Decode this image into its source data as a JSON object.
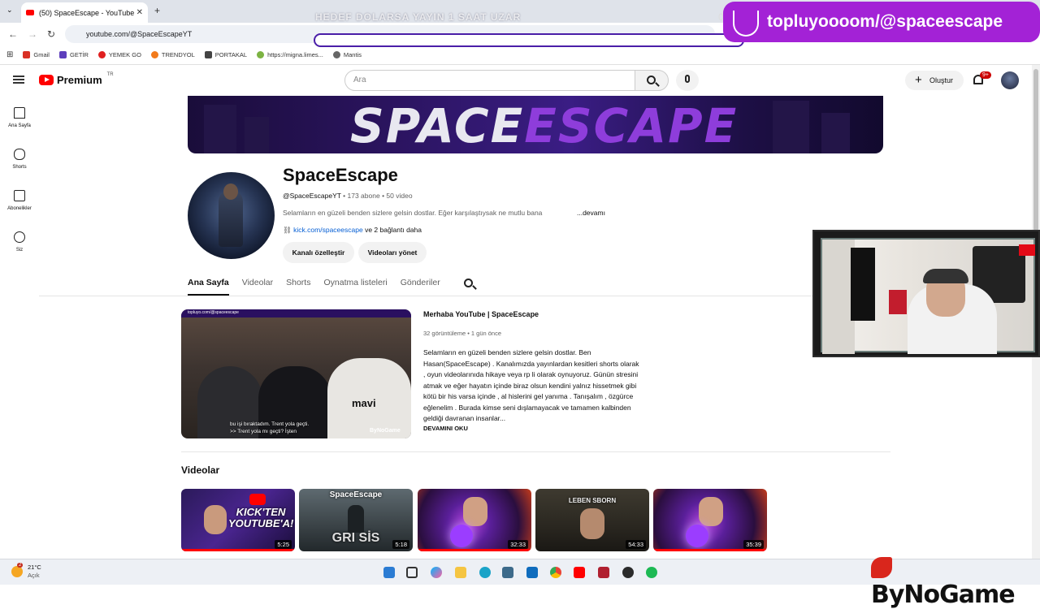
{
  "browser": {
    "tab_title": "(50) SpaceEscape - YouTube",
    "url": "youtube.com/@SpaceEscapeYT",
    "bookmarks": [
      "Gmail",
      "GETİR",
      "YEMEK GO",
      "TRENDYOL",
      "PORTAKAL",
      "https://migna.limes...",
      "Mantis"
    ]
  },
  "overlay": {
    "marquee": "HEDEF DOLARSA YAYIN 1 SAAT UZAR",
    "counter": "0",
    "kick": "topluyoooom/@spaceescape",
    "brand": "ByNoGame"
  },
  "yt": {
    "logo": "Premium",
    "region": "TR",
    "search_placeholder": "Ara",
    "create": "Oluştur",
    "notif_count": "9+",
    "nav": [
      "Ana Sayfa",
      "Shorts",
      "Abonelikler",
      "Siz"
    ]
  },
  "channel": {
    "banner_text_a": "SPACE",
    "banner_text_b": "ESCAPE",
    "name": "SpaceEscape",
    "handle": "@SpaceEscapeYT",
    "subs": "173 abone",
    "videos": "50 video",
    "description": "Selamların en güzeli benden sizlere gelsin dostlar. Eğer karşılaştıysak ne mutlu bana",
    "more": "...devamı",
    "link": "kick.com/spaceescape",
    "link_more": "ve 2 bağlantı daha",
    "btn_customize": "Kanalı özelleştir",
    "btn_manage": "Videoları yönet",
    "tabs": [
      "Ana Sayfa",
      "Videolar",
      "Shorts",
      "Oynatma listeleri",
      "Gönderiler"
    ]
  },
  "featured": {
    "title": "Merhaba YouTube | SpaceEscape",
    "meta": "32 görüntüleme • 1 gün önce",
    "description": "Selamların en güzeli benden sizlere gelsin dostlar. Ben Hasan(SpaceEscape) . Kanalımızda yayınlardan kesitleri shorts olarak , oyun videolarınıda hikaye veya rp li olarak oynuyoruz. Günün stresini atmak ve eğer hayatın içinde biraz olsun kendini yalnız hissetmek gibi kötü bir his varsa içinde , al hislerini gel yanıma . Tanışalım , özgürce eğlenelim . Burada kimse seni dışlamayacak ve tamamen kalbinden geldiği davranan insanlar...",
    "read_more": "DEVAMINI OKU",
    "caption1": "bu işi bıraktadım. Trent yola geçti.",
    "caption2": ">> Trent yola mı geçti? İşten",
    "shirt": "mavi",
    "overlay_kick": "topluyo.com/@spaceescape"
  },
  "videos_section": {
    "heading": "Videolar",
    "items": [
      {
        "title_overlay": "KICK'TEN YOUTUBE'A!",
        "duration": "5:25"
      },
      {
        "title_overlay": "GRİ SİS",
        "top": "SpaceEscape",
        "duration": "5:18"
      },
      {
        "title_overlay": "",
        "duration": "32:33"
      },
      {
        "title_overlay": "LEBEN SBORN",
        "duration": "54:33"
      },
      {
        "title_overlay": "",
        "duration": "35:39"
      }
    ]
  },
  "taskbar": {
    "temp": "21°C",
    "weather": "Açık",
    "weather_badge": "2"
  }
}
